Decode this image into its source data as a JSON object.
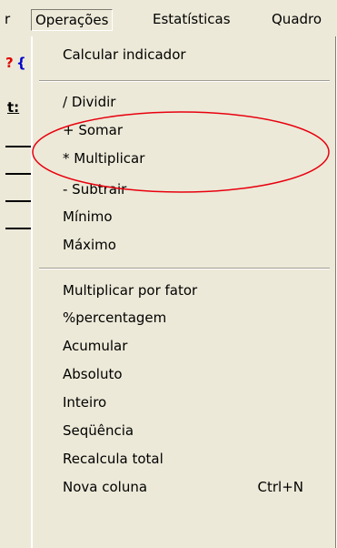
{
  "menubar": {
    "partial_left": "r",
    "operacoes": "Operações",
    "estatisticas": "Estatísticas",
    "quadro": "Quadro"
  },
  "left_strip": {
    "glyph_red": "?",
    "glyph_blue": "{",
    "glyph_black": "t:"
  },
  "menu": {
    "calcular": "Calcular indicador",
    "dividir": "/ Dividir",
    "somar": "+ Somar",
    "multiplicar": "* Multiplicar",
    "subtrair": "- Subtrair",
    "minimo": "Mínimo",
    "maximo": "Máximo",
    "multiplicar_fator": "Multiplicar por fator",
    "percentagem": "%percentagem",
    "acumular": "Acumular",
    "absoluto": "Absoluto",
    "inteiro": "Inteiro",
    "sequencia": "Seqüência",
    "recalcula": "Recalcula total",
    "nova_coluna": "Nova coluna",
    "nova_coluna_shortcut": "Ctrl+N"
  },
  "colors": {
    "menu_bg": "#ece9d8",
    "annotation_red": "#e8000e",
    "glyph_red": "#e00000",
    "glyph_blue": "#0000cc"
  }
}
